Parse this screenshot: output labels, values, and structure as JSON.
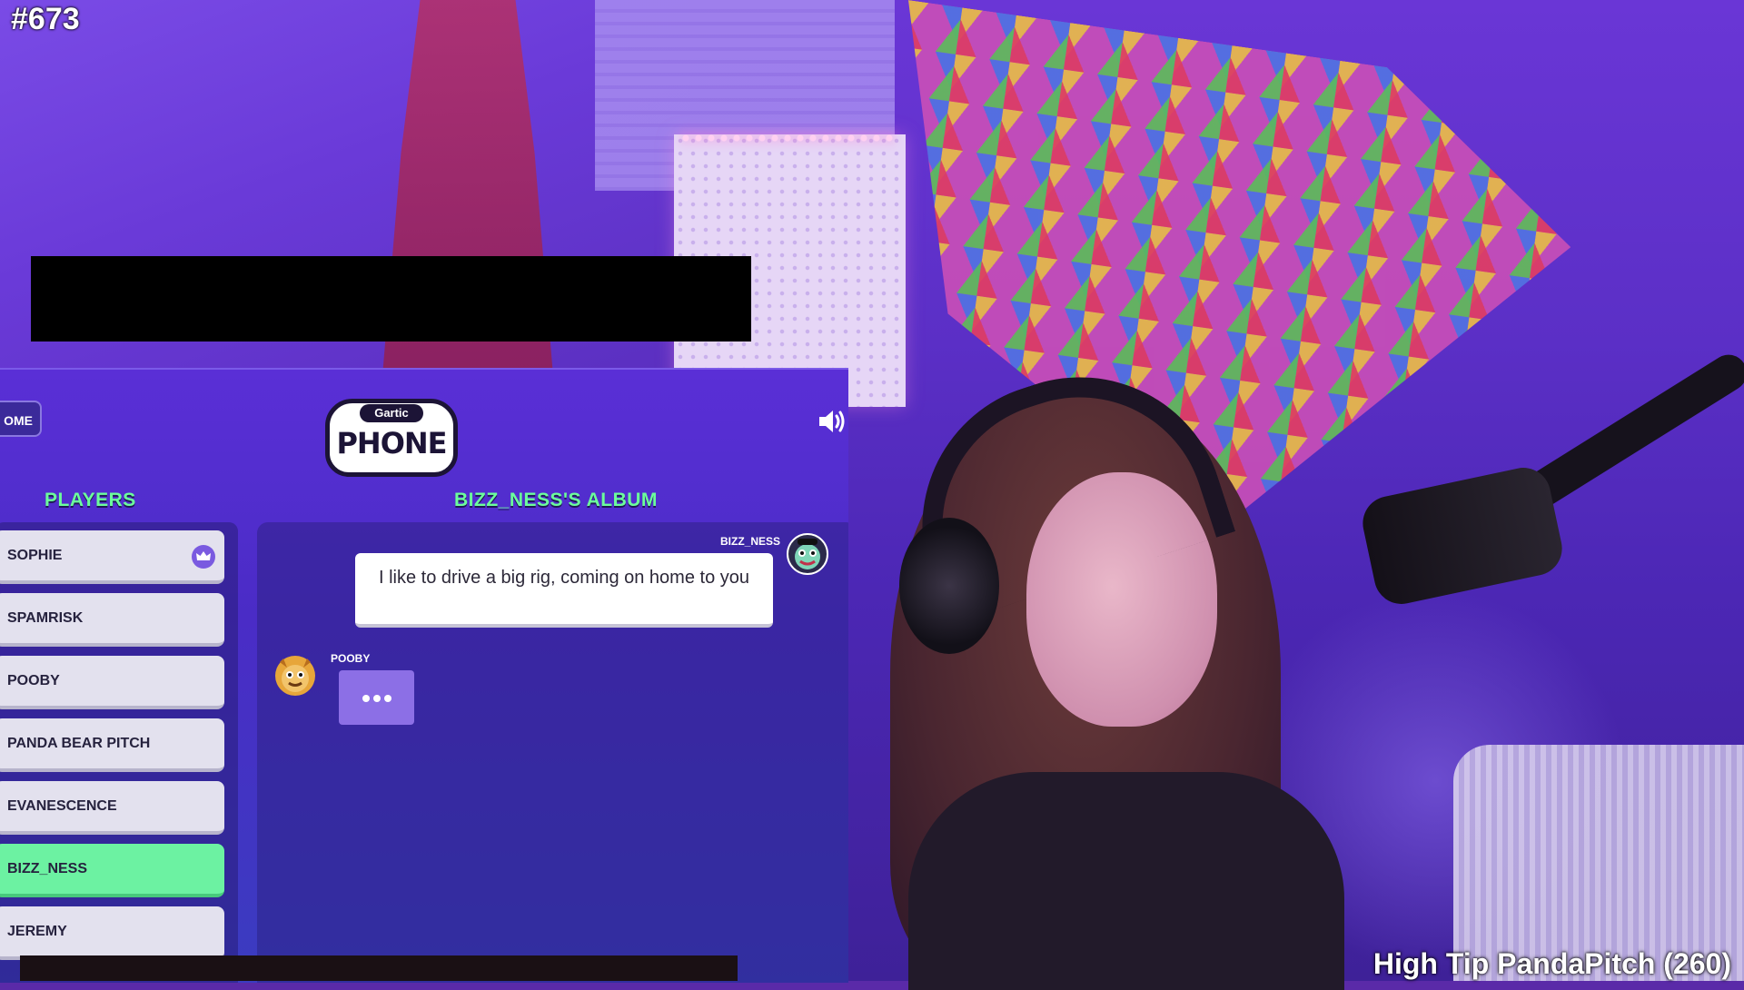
{
  "overlay": {
    "stream_number": "#673",
    "high_tip": "High Tip  PandaPitch (260)"
  },
  "game": {
    "home_button": "OME",
    "logo": {
      "top": "Gartic",
      "main": "PHONE"
    },
    "players_heading": "PLAYERS",
    "album_heading": "BIZZ_NESS'S ALBUM",
    "players": [
      {
        "name": "SOPHIE",
        "host": true,
        "active": false
      },
      {
        "name": "SPAMRISK",
        "host": false,
        "active": false
      },
      {
        "name": "POOBY",
        "host": false,
        "active": false
      },
      {
        "name": "PANDA BEAR PITCH",
        "host": false,
        "active": false
      },
      {
        "name": "EVANESCENCE",
        "host": false,
        "active": false
      },
      {
        "name": "BIZZ_NESS",
        "host": false,
        "active": true
      },
      {
        "name": "JEREMY",
        "host": false,
        "active": false
      }
    ],
    "album": {
      "message_author": "BIZZ_NESS",
      "message_text": "I like to drive a big rig, coming on home to you",
      "typing_author": "POOBY"
    }
  },
  "icons": {
    "sound": "speaker-icon",
    "crown": "crown-icon",
    "typing": "ellipsis-icon"
  },
  "colors": {
    "accent_green": "#6cff9c",
    "active_player": "#6cf2a2",
    "player_row": "#e3e1ee",
    "panel_purple": "#5a2fd6"
  }
}
